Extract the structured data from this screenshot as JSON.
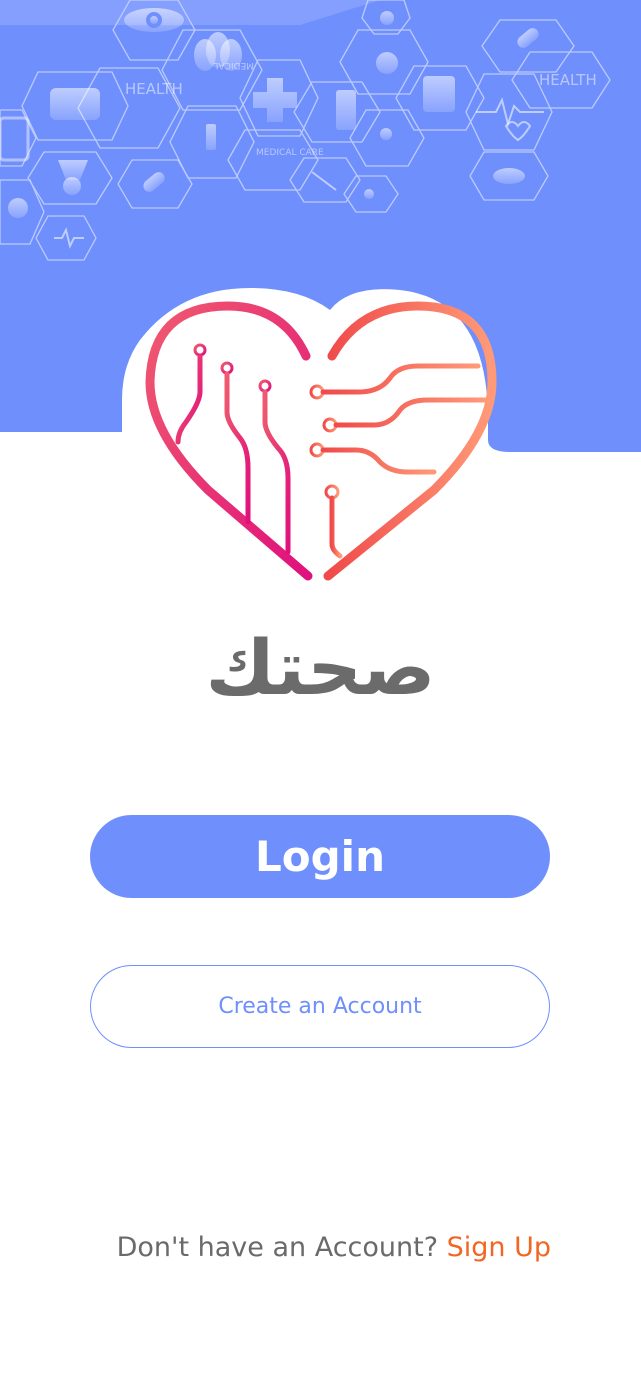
{
  "colors": {
    "header_blue": "#6f8ffd",
    "brand_text": "#6b6b6b",
    "login_text": "#ffffff",
    "create_text": "#6f8ffd",
    "signup_text": "#6a6a6a",
    "signup_link": "#f26522",
    "heart_left": "#e5197a",
    "heart_right": "#ff8a6a"
  },
  "header": {
    "pattern_labels": [
      "HEALTH",
      "MEDICAL",
      "MEDICAL CARE",
      "HEALTH"
    ],
    "pattern_icons": [
      "eye-icon",
      "tooth-icon",
      "medal-icon",
      "first-aid-kit-icon",
      "medical-cross-icon",
      "test-tubes-icon",
      "microscope-icon",
      "tablet-icon",
      "heartbeat-icon",
      "pill-icon",
      "virus-icon",
      "syringe-icon"
    ]
  },
  "brand": {
    "logo_icon": "circuit-heart-icon",
    "app_name": "صحتك"
  },
  "actions": {
    "login_label": "Login",
    "create_account_label": "Create an Account"
  },
  "footer": {
    "prompt_text": "Don't have an Account?",
    "signup_label": "Sign Up"
  }
}
